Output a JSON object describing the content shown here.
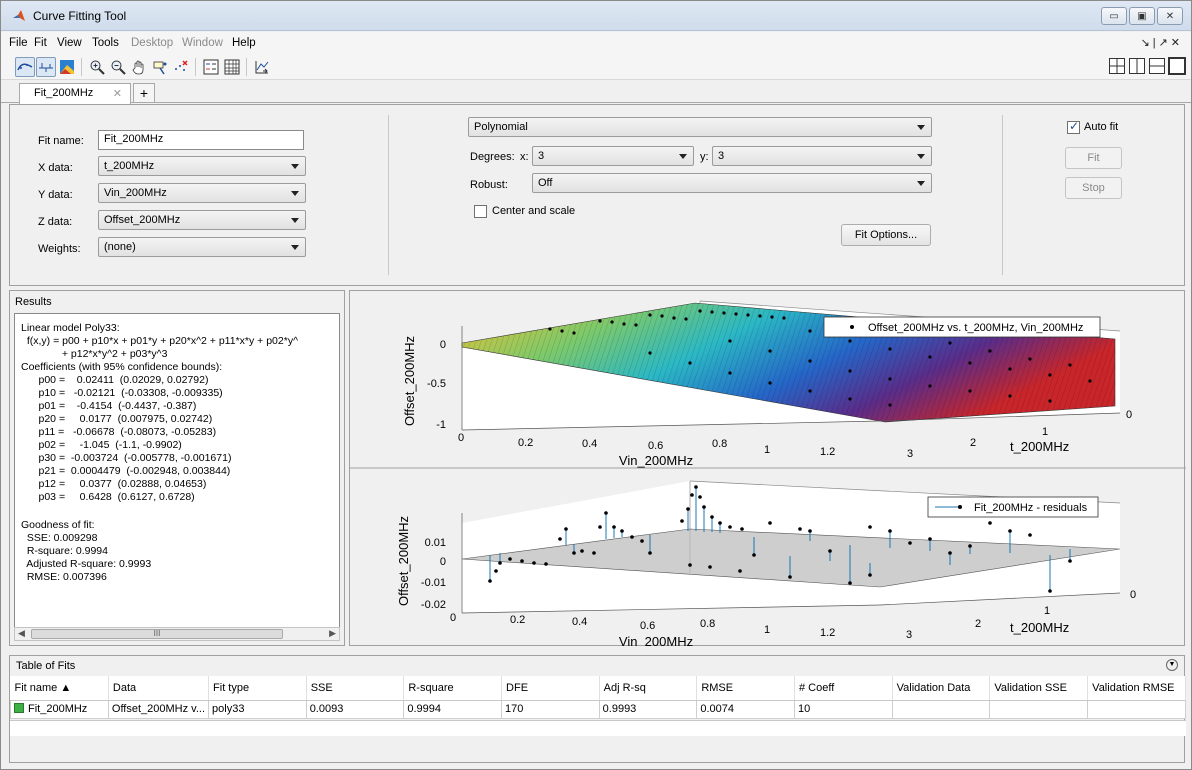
{
  "window": {
    "title": "Curve Fitting Tool"
  },
  "menu": [
    "File",
    "Fit",
    "View",
    "Tools",
    "Desktop",
    "Window",
    "Help"
  ],
  "tabs": {
    "active": "Fit_200MHz",
    "add": "+"
  },
  "fit": {
    "name_label": "Fit name:",
    "name_value": "Fit_200MHz",
    "x_label": "X data:",
    "x_value": "t_200MHz",
    "y_label": "Y data:",
    "y_value": "Vin_200MHz",
    "z_label": "Z data:",
    "z_value": "Offset_200MHz",
    "w_label": "Weights:",
    "w_value": "(none)",
    "type": "Polynomial",
    "degrees_label": "Degrees:",
    "deg_x_label": "x:",
    "deg_x": "3",
    "deg_y_label": "y:",
    "deg_y": "3",
    "robust_label": "Robust:",
    "robust_value": "Off",
    "center_scale": "Center and scale",
    "fit_options": "Fit Options...",
    "auto_fit": "Auto fit",
    "fit_btn": "Fit",
    "stop_btn": "Stop"
  },
  "results": {
    "title": "Results",
    "lines": [
      "Linear model Poly33:",
      "  f(x,y) = p00 + p10*x + p01*y + p20*x^2 + p11*x*y + p02*y^",
      "              + p12*x*y^2 + p03*y^3",
      "Coefficients (with 95% confidence bounds):",
      "      p00 =    0.02411  (0.02029, 0.02792)",
      "      p10 =   -0.02121  (-0.03308, -0.009335)",
      "      p01 =    -0.4154  (-0.4437, -0.387)",
      "      p20 =     0.0177  (0.007975, 0.02742)",
      "      p11 =   -0.06678  (-0.08073, -0.05283)",
      "      p02 =     -1.045  (-1.1, -0.9902)",
      "      p30 =  -0.003724  (-0.005778, -0.001671)",
      "      p21 =  0.0004479  (-0.002948, 0.003844)",
      "      p12 =     0.0377  (0.02888, 0.04653)",
      "      p03 =     0.6428  (0.6127, 0.6728)",
      "",
      "Goodness of fit:",
      "  SSE: 0.009298",
      "  R-square: 0.9994",
      "  Adjusted R-square: 0.9993",
      "  RMSE: 0.007396"
    ],
    "scroll_thumb": "III"
  },
  "chart_data": [
    {
      "type": "surface",
      "xlabel": "Vin_200MHz",
      "ylabel": "t_200MHz",
      "zlabel": "Offset_200MHz",
      "x_ticks": [
        "0",
        "0.2",
        "0.4",
        "0.6",
        "0.8",
        "1",
        "1.2"
      ],
      "y_ticks": [
        "0",
        "1",
        "2",
        "3"
      ],
      "z_ticks": [
        "0",
        "-0.5",
        "-1"
      ],
      "legend": "Offset_200MHz vs. t_200MHz, Vin_200MHz",
      "legend_placement": "top-right",
      "zlim": [
        -1,
        0.1
      ]
    },
    {
      "type": "scatter",
      "xlabel": "Vin_200MHz",
      "ylabel": "t_200MHz",
      "zlabel": "Offset_200MHz",
      "x_ticks": [
        "0",
        "0.2",
        "0.4",
        "0.6",
        "0.8",
        "1",
        "1.2"
      ],
      "y_ticks": [
        "0",
        "1",
        "2",
        "3"
      ],
      "z_ticks": [
        "0.01",
        "0",
        "-0.01",
        "-0.02"
      ],
      "legend": "Fit_200MHz - residuals",
      "legend_placement": "top-right",
      "zlim": [
        -0.02,
        0.015
      ]
    }
  ],
  "table": {
    "title": "Table of Fits",
    "headers": [
      "Fit name ▲",
      "Data",
      "Fit type",
      "SSE",
      "R-square",
      "DFE",
      "Adj R-sq",
      "RMSE",
      "# Coeff",
      "Validation Data",
      "Validation SSE",
      "Validation RMSE"
    ],
    "rows": [
      [
        "Fit_200MHz",
        "Offset_200MHz v...",
        "poly33",
        "0.0093",
        "0.9994",
        "170",
        "0.9993",
        "0.0074",
        "10",
        "",
        "",
        ""
      ]
    ]
  },
  "colors": {
    "accent": "#1f77b4",
    "status_ok": "#3cb043"
  }
}
